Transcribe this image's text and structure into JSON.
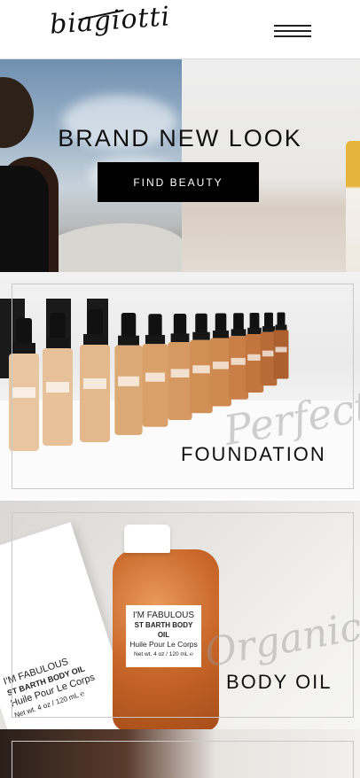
{
  "header": {
    "logo_text": "biagiotti",
    "menu_icon": "hamburger-menu-icon"
  },
  "hero": {
    "title": "BRAND NEW LOOK",
    "button_label": "FIND BEAUTY"
  },
  "cards": [
    {
      "script_text": "Perfect",
      "caption": "FOUNDATION"
    },
    {
      "script_text": "Organic",
      "caption": "BODY OIL"
    }
  ],
  "oil_product": {
    "label_line1": "I'M FABULOUS",
    "label_line2": "ST BARTH BODY OIL",
    "label_line3": "Huile Pour Le Corps",
    "label_line4": "Net wt. 4 oz / 120 mL ℮",
    "box_line1": "I'M FABULOUS",
    "box_line2": "ST BARTH BODY OIL",
    "box_line3": "Huile Pour Le Corps",
    "box_line4": "Net wt. 4 oz / 120 mL ℮"
  },
  "colors": {
    "accent": "#000000",
    "button_text": "#ffffff",
    "frame": "#c9c9c9"
  }
}
